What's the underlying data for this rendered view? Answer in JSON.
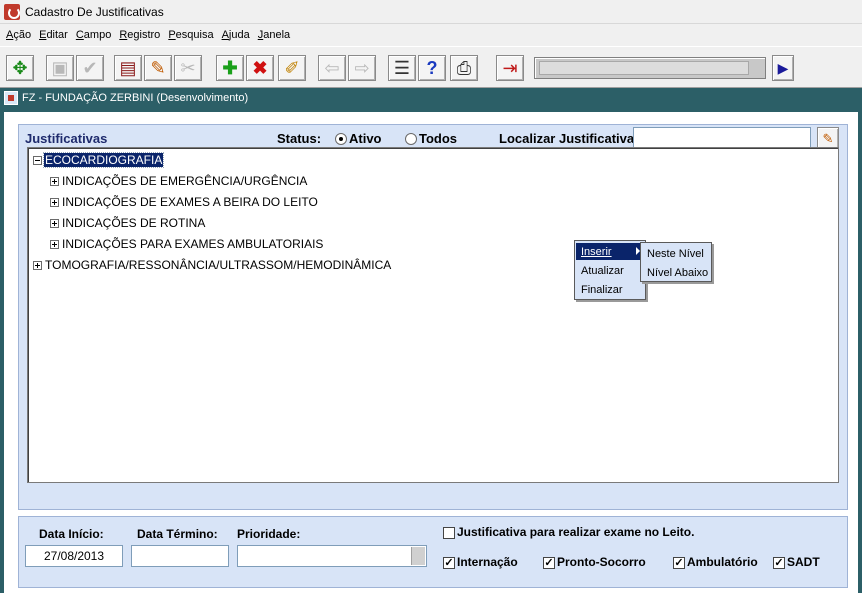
{
  "window": {
    "title": "Cadastro De Justificativas"
  },
  "menu": [
    "Ação",
    "Editar",
    "Campo",
    "Registro",
    "Pesquisa",
    "Ajuda",
    "Janela"
  ],
  "toolbar_icons": [
    "move-icon",
    "save-icon",
    "check-icon",
    "print-preview-icon",
    "edit-icon",
    "cut-icon",
    "add-icon",
    "delete-icon",
    "clear-icon",
    "arrow-left-icon",
    "arrow-right-icon",
    "list-icon",
    "help-icon",
    "print-icon",
    "exit-icon",
    "next-icon"
  ],
  "inner_window": {
    "title": "FZ - FUNDAÇÃO ZERBINI (Desenvolvimento)"
  },
  "header": {
    "section_label": "Justificativas",
    "status_label": "Status:",
    "radio_active": "Ativo",
    "radio_all": "Todos",
    "radio_selected": "Ativo",
    "search_label": "Localizar Justificativa:",
    "search_value": ""
  },
  "tree": {
    "root": "ECOCARDIOGRAFIA",
    "children": [
      "INDICAÇÕES DE EMERGÊNCIA/URGÊNCIA",
      "INDICAÇÕES DE EXAMES A BEIRA DO LEITO",
      "INDICAÇÕES DE ROTINA",
      "INDICAÇÕES PARA EXAMES AMBULATORIAIS"
    ],
    "root2": "TOMOGRAFIA/RESSONÂNCIA/ULTRASSOM/HEMODINÂMICA"
  },
  "context_menu": {
    "items": [
      "Inserir",
      "Atualizar",
      "Finalizar"
    ],
    "submenu": [
      "Neste Nível",
      "Nível Abaixo"
    ]
  },
  "footer": {
    "start_label": "Data Início:",
    "start_value": "27/08/2013",
    "end_label": "Data Término:",
    "end_value": "",
    "priority_label": "Prioridade:",
    "priority_value": "",
    "bed_label": "Justificativa para realizar exame no Leito.",
    "bed_checked": false,
    "checks": [
      {
        "label": "Internação",
        "checked": true
      },
      {
        "label": "Pronto-Socorro",
        "checked": true
      },
      {
        "label": "Ambulatório",
        "checked": true
      },
      {
        "label": "SADT",
        "checked": true
      }
    ]
  }
}
